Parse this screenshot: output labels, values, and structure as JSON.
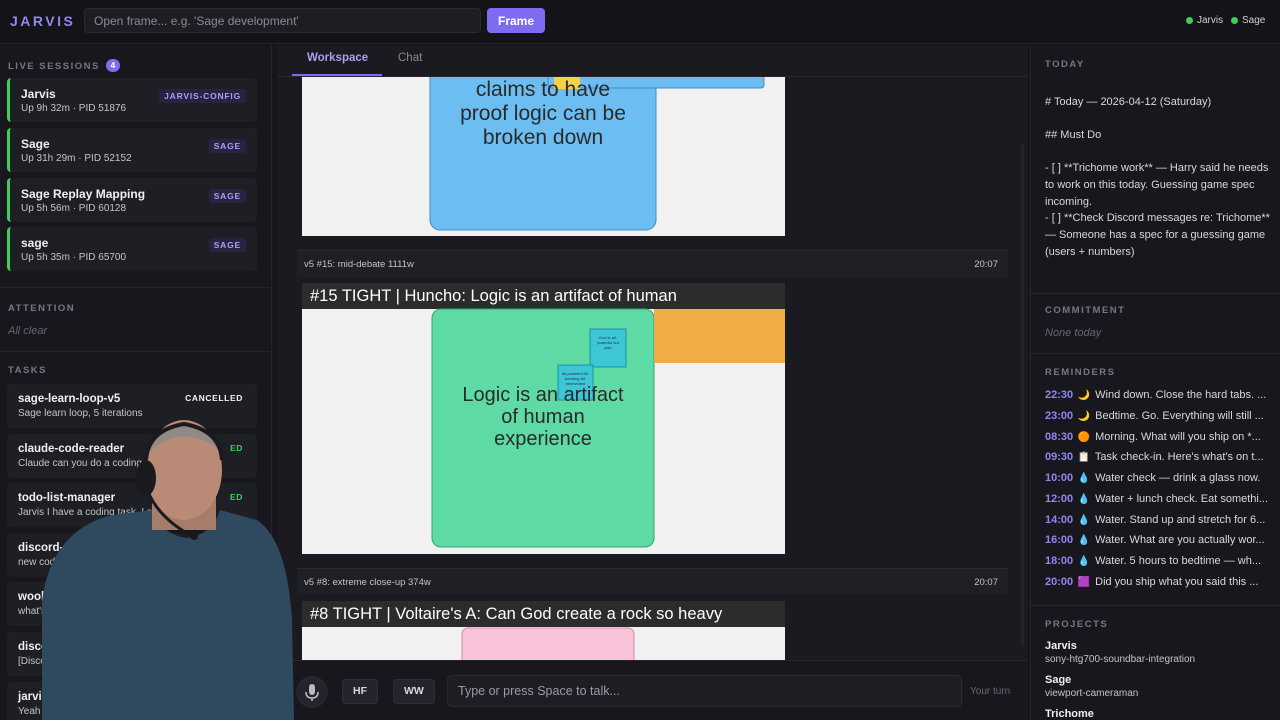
{
  "app": {
    "logo": "JARVIS"
  },
  "topbar": {
    "frame_placeholder": "Open frame... e.g. 'Sage development'",
    "frame_button": "Frame",
    "status": [
      {
        "label": "Jarvis",
        "color": "#3ad15a"
      },
      {
        "label": "Sage",
        "color": "#3ad15a"
      }
    ]
  },
  "left": {
    "live_title": "LIVE SESSIONS",
    "live_count": "4",
    "sessions": [
      {
        "name": "Jarvis",
        "meta": "Up 9h 32m · PID 51876",
        "tag": "JARVIS-CONFIG"
      },
      {
        "name": "Sage",
        "meta": "Up 31h 29m · PID 52152",
        "tag": "SAGE"
      },
      {
        "name": "Sage Replay Mapping",
        "meta": "Up 5h 56m · PID 60128",
        "tag": "SAGE"
      },
      {
        "name": "sage",
        "meta": "Up 5h 35m · PID 65700",
        "tag": "SAGE"
      }
    ],
    "attention_title": "ATTENTION",
    "attention_empty": "All clear",
    "tasks_title": "TASKS",
    "tasks": [
      {
        "name": "sage-learn-loop-v5",
        "sub": "Sage learn loop, 5 iterations",
        "status": "CANCELLED"
      },
      {
        "name": "claude-code-reader",
        "sub": "Claude can you do a coding",
        "status": "ED"
      },
      {
        "name": "todo-list-manager",
        "sub": "Jarvis I have a coding task. I n",
        "status": "ED"
      },
      {
        "name": "discord-user-m",
        "sub": "new coding ta",
        "status": ""
      },
      {
        "name": "woolwort",
        "sub": "what's the",
        "status": ""
      },
      {
        "name": "discord",
        "sub": "[Discord",
        "status": ""
      },
      {
        "name": "jarvis-",
        "sub": "Yeah d",
        "status": ""
      }
    ]
  },
  "main": {
    "tabs": [
      {
        "label": "Workspace",
        "active": true
      },
      {
        "label": "Chat",
        "active": false
      }
    ],
    "cards": [
      {
        "caption": "v5 #15: mid-debate 1111w",
        "time": "20:07",
        "title": "#15 TIGHT | Huncho: Logic is an artifact of human",
        "body": "Logic is an artifact\nof human\nexperience",
        "sticky1": "God is all-powerful but pain",
        "sticky2": "All-powerful All-knowing All-benevolent"
      },
      {
        "caption": "v5 #8: extreme close-up 374w",
        "time": "20:07",
        "title": "#8 TIGHT | Voltaire's A: Can God create a rock so heavy"
      }
    ],
    "top_frame_text": "claims to have\nproof logic can be\nbroken down",
    "composer": {
      "placeholder": "Type or press Space to talk...",
      "hf": "HF",
      "ww": "WW",
      "turn": "Your turn"
    }
  },
  "right": {
    "today_title": "TODAY",
    "today_heading": "# Today — 2026-04-12 (Saturday)",
    "must_do": "## Must Do",
    "item1": "- [ ] **Trichome work** — Harry said he needs to work on this today. Guessing game spec incoming.",
    "item2": "- [ ] **Check Discord messages re: Trichome** — Someone has a spec for a guessing game (users + numbers)",
    "commitment_title": "COMMITMENT",
    "commitment_empty": "None today",
    "reminders_title": "REMINDERS",
    "reminders": [
      {
        "time": "22:30",
        "icon": "🌙",
        "text": "Wind down. Close the hard tabs. ..."
      },
      {
        "time": "23:00",
        "icon": "🌙",
        "text": "Bedtime. Go. Everything will still ..."
      },
      {
        "time": "08:30",
        "icon": "🟠",
        "text": "Morning. What will you ship on *..."
      },
      {
        "time": "09:30",
        "icon": "📋",
        "text": "Task check-in. Here's what's on t..."
      },
      {
        "time": "10:00",
        "icon": "💧",
        "text": "Water check — drink a glass now."
      },
      {
        "time": "12:00",
        "icon": "💧",
        "text": "Water + lunch check. Eat somethi..."
      },
      {
        "time": "14:00",
        "icon": "💧",
        "text": "Water. Stand up and stretch for 6..."
      },
      {
        "time": "16:00",
        "icon": "💧",
        "text": "Water. What are you actually wor..."
      },
      {
        "time": "18:00",
        "icon": "💧",
        "text": "Water. 5 hours to bedtime — wh..."
      },
      {
        "time": "20:00",
        "icon": "🟪",
        "text": "Did you ship what you said this ..."
      }
    ],
    "projects_title": "PROJECTS",
    "projects": [
      {
        "name": "Jarvis",
        "sub": "sony-htg700-soundbar-integration"
      },
      {
        "name": "Sage",
        "sub": "viewport-cameraman"
      },
      {
        "name": "Trichome",
        "sub": ""
      }
    ]
  }
}
